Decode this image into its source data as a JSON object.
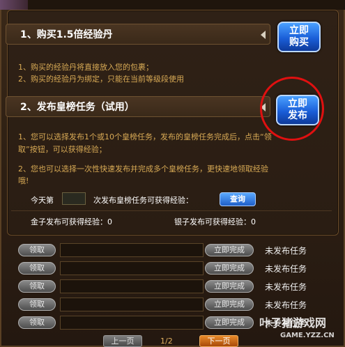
{
  "section1": {
    "title": "1、购买1.5倍经验丹",
    "button_line1": "立即",
    "button_line2": "购买",
    "notes": [
      "1、购买的经验丹将直接放入您的包裹；",
      "2、购买的经验丹为绑定，只能在当前等级段使用"
    ]
  },
  "section2": {
    "title": "2、发布皇榜任务（试用）",
    "button_line1": "立即",
    "button_line2": "发布",
    "notes": [
      "1、您可以选择发布1个或10个皇榜任务，发布的皇榜任务完成后，点击“领",
      "取”按钮，可以获得经验；",
      "2、您也可以选择一次性快速发布并完成多个皇榜任务，更快速地领取经验",
      "哦!"
    ],
    "query_prefix": "今天第",
    "query_suffix": "次发布皇榜任务可获得经验：",
    "query_button": "查询",
    "gold_label": "金子发布可获得经验：0",
    "silver_label": "银子发布可获得经验：0"
  },
  "task_rows": [
    {
      "claim": "领取",
      "finish": "立即完成",
      "status": "未发布任务"
    },
    {
      "claim": "领取",
      "finish": "立即完成",
      "status": "未发布任务"
    },
    {
      "claim": "领取",
      "finish": "立即完成",
      "status": "未发布任务"
    },
    {
      "claim": "领取",
      "finish": "立即完成",
      "status": "未发布任务"
    },
    {
      "claim": "领取",
      "finish": "立即完成",
      "status": "未发布任务"
    }
  ],
  "pager": {
    "prev": "上一页",
    "info": "1/2",
    "next": "下一页"
  },
  "watermark": {
    "main": "叶子猪游戏网",
    "sub": "GAME.YZZ.CN"
  }
}
